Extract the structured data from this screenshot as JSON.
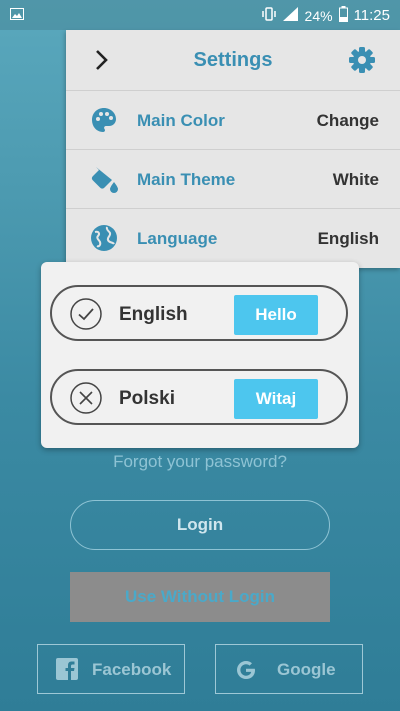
{
  "statusbar": {
    "battery": "24%",
    "time": "11:25"
  },
  "settings": {
    "title": "Settings",
    "rows": [
      {
        "label": "Main Color",
        "value": "Change"
      },
      {
        "label": "Main Theme",
        "value": "White"
      },
      {
        "label": "Language",
        "value": "English"
      }
    ]
  },
  "dialog": {
    "options": [
      {
        "name": "English",
        "greeting": "Hello",
        "selected": true
      },
      {
        "name": "Polski",
        "greeting": "Witaj",
        "selected": false
      }
    ]
  },
  "login": {
    "forgot": "Forgot your password?",
    "login_label": "Login",
    "without_login_label": "Use Without Login",
    "facebook_label": "Facebook",
    "google_label": "Google"
  },
  "colors": {
    "accent": "#3a8fb3",
    "greeting_button": "#4dc6ee",
    "panel": "#e6e6e6"
  }
}
